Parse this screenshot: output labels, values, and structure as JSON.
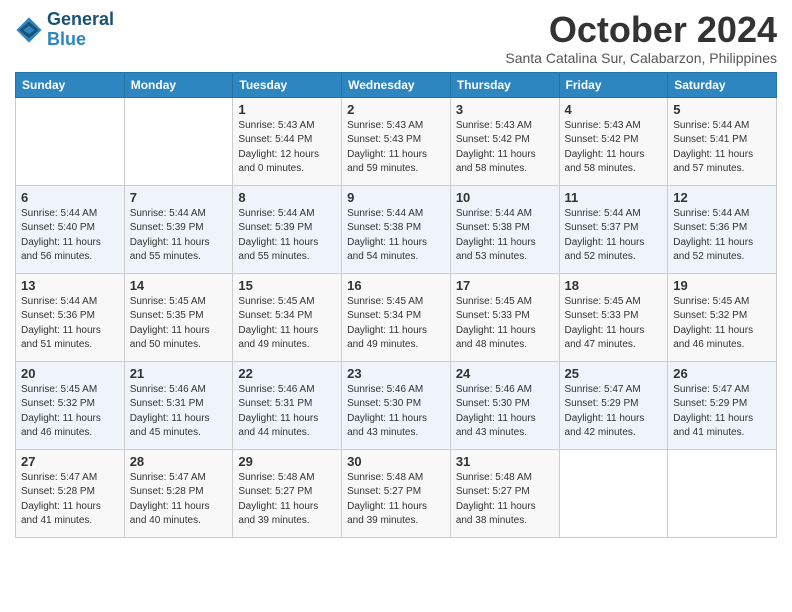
{
  "header": {
    "logo_line1": "General",
    "logo_line2": "Blue",
    "month": "October 2024",
    "location": "Santa Catalina Sur, Calabarzon, Philippines"
  },
  "days_of_week": [
    "Sunday",
    "Monday",
    "Tuesday",
    "Wednesday",
    "Thursday",
    "Friday",
    "Saturday"
  ],
  "weeks": [
    [
      {
        "day": "",
        "info": ""
      },
      {
        "day": "",
        "info": ""
      },
      {
        "day": "1",
        "info": "Sunrise: 5:43 AM\nSunset: 5:44 PM\nDaylight: 12 hours\nand 0 minutes."
      },
      {
        "day": "2",
        "info": "Sunrise: 5:43 AM\nSunset: 5:43 PM\nDaylight: 11 hours\nand 59 minutes."
      },
      {
        "day": "3",
        "info": "Sunrise: 5:43 AM\nSunset: 5:42 PM\nDaylight: 11 hours\nand 58 minutes."
      },
      {
        "day": "4",
        "info": "Sunrise: 5:43 AM\nSunset: 5:42 PM\nDaylight: 11 hours\nand 58 minutes."
      },
      {
        "day": "5",
        "info": "Sunrise: 5:44 AM\nSunset: 5:41 PM\nDaylight: 11 hours\nand 57 minutes."
      }
    ],
    [
      {
        "day": "6",
        "info": "Sunrise: 5:44 AM\nSunset: 5:40 PM\nDaylight: 11 hours\nand 56 minutes."
      },
      {
        "day": "7",
        "info": "Sunrise: 5:44 AM\nSunset: 5:39 PM\nDaylight: 11 hours\nand 55 minutes."
      },
      {
        "day": "8",
        "info": "Sunrise: 5:44 AM\nSunset: 5:39 PM\nDaylight: 11 hours\nand 55 minutes."
      },
      {
        "day": "9",
        "info": "Sunrise: 5:44 AM\nSunset: 5:38 PM\nDaylight: 11 hours\nand 54 minutes."
      },
      {
        "day": "10",
        "info": "Sunrise: 5:44 AM\nSunset: 5:38 PM\nDaylight: 11 hours\nand 53 minutes."
      },
      {
        "day": "11",
        "info": "Sunrise: 5:44 AM\nSunset: 5:37 PM\nDaylight: 11 hours\nand 52 minutes."
      },
      {
        "day": "12",
        "info": "Sunrise: 5:44 AM\nSunset: 5:36 PM\nDaylight: 11 hours\nand 52 minutes."
      }
    ],
    [
      {
        "day": "13",
        "info": "Sunrise: 5:44 AM\nSunset: 5:36 PM\nDaylight: 11 hours\nand 51 minutes."
      },
      {
        "day": "14",
        "info": "Sunrise: 5:45 AM\nSunset: 5:35 PM\nDaylight: 11 hours\nand 50 minutes."
      },
      {
        "day": "15",
        "info": "Sunrise: 5:45 AM\nSunset: 5:34 PM\nDaylight: 11 hours\nand 49 minutes."
      },
      {
        "day": "16",
        "info": "Sunrise: 5:45 AM\nSunset: 5:34 PM\nDaylight: 11 hours\nand 49 minutes."
      },
      {
        "day": "17",
        "info": "Sunrise: 5:45 AM\nSunset: 5:33 PM\nDaylight: 11 hours\nand 48 minutes."
      },
      {
        "day": "18",
        "info": "Sunrise: 5:45 AM\nSunset: 5:33 PM\nDaylight: 11 hours\nand 47 minutes."
      },
      {
        "day": "19",
        "info": "Sunrise: 5:45 AM\nSunset: 5:32 PM\nDaylight: 11 hours\nand 46 minutes."
      }
    ],
    [
      {
        "day": "20",
        "info": "Sunrise: 5:45 AM\nSunset: 5:32 PM\nDaylight: 11 hours\nand 46 minutes."
      },
      {
        "day": "21",
        "info": "Sunrise: 5:46 AM\nSunset: 5:31 PM\nDaylight: 11 hours\nand 45 minutes."
      },
      {
        "day": "22",
        "info": "Sunrise: 5:46 AM\nSunset: 5:31 PM\nDaylight: 11 hours\nand 44 minutes."
      },
      {
        "day": "23",
        "info": "Sunrise: 5:46 AM\nSunset: 5:30 PM\nDaylight: 11 hours\nand 43 minutes."
      },
      {
        "day": "24",
        "info": "Sunrise: 5:46 AM\nSunset: 5:30 PM\nDaylight: 11 hours\nand 43 minutes."
      },
      {
        "day": "25",
        "info": "Sunrise: 5:47 AM\nSunset: 5:29 PM\nDaylight: 11 hours\nand 42 minutes."
      },
      {
        "day": "26",
        "info": "Sunrise: 5:47 AM\nSunset: 5:29 PM\nDaylight: 11 hours\nand 41 minutes."
      }
    ],
    [
      {
        "day": "27",
        "info": "Sunrise: 5:47 AM\nSunset: 5:28 PM\nDaylight: 11 hours\nand 41 minutes."
      },
      {
        "day": "28",
        "info": "Sunrise: 5:47 AM\nSunset: 5:28 PM\nDaylight: 11 hours\nand 40 minutes."
      },
      {
        "day": "29",
        "info": "Sunrise: 5:48 AM\nSunset: 5:27 PM\nDaylight: 11 hours\nand 39 minutes."
      },
      {
        "day": "30",
        "info": "Sunrise: 5:48 AM\nSunset: 5:27 PM\nDaylight: 11 hours\nand 39 minutes."
      },
      {
        "day": "31",
        "info": "Sunrise: 5:48 AM\nSunset: 5:27 PM\nDaylight: 11 hours\nand 38 minutes."
      },
      {
        "day": "",
        "info": ""
      },
      {
        "day": "",
        "info": ""
      }
    ]
  ]
}
